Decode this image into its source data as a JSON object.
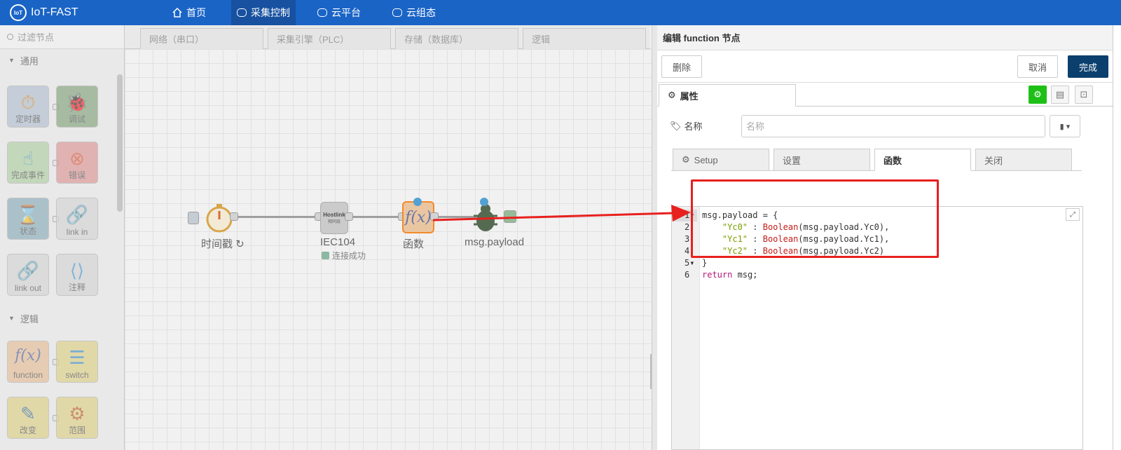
{
  "app": {
    "name": "IoT-FAST",
    "logo_text": "IoT"
  },
  "nav": [
    {
      "label": "首页",
      "icon": "home-icon"
    },
    {
      "label": "采集控制",
      "icon": "cloud-gear-icon",
      "active": true
    },
    {
      "label": "云平台",
      "icon": "cloud-icon"
    },
    {
      "label": "云组态",
      "icon": "cloud-config-icon"
    }
  ],
  "palette": {
    "filter_placeholder": "过滤节点",
    "categories": {
      "common": "通用",
      "logic": "逻辑"
    },
    "nodes": {
      "timer": "定时器",
      "debug": "调试",
      "complete": "完成事件",
      "error": "错误",
      "status": "状态",
      "link_in": "link in",
      "link_out": "link out",
      "comment": "注释",
      "function": "function",
      "switch": "switch",
      "change": "改变",
      "range": "范围"
    }
  },
  "workspace_tabs": [
    "网络（串口）",
    "采集引擎（PLC）",
    "存储（数据库）",
    "逻辑"
  ],
  "flow": {
    "timestamp_label": "时间戳 ↻",
    "iec_label": "IEC104",
    "iec_badge": "Hostlink",
    "iec_badge_sub": "相同层",
    "iec_status": "连接成功",
    "func_label": "函数",
    "debug_label": "msg.payload"
  },
  "editor": {
    "title": "编辑 function 节点",
    "delete_label": "删除",
    "cancel_label": "取消",
    "done_label": "完成",
    "props_tab": "属性",
    "name_label": "名称",
    "name_placeholder": "名称",
    "sub_tabs": [
      "Setup",
      "设置",
      "函数",
      "关闭"
    ],
    "active_sub_tab": 2,
    "code": [
      {
        "n": "1",
        "fold": true,
        "text": "msg.payload = {"
      },
      {
        "n": "2",
        "text": "    \"Yc0\" : Boolean(msg.payload.Yc0),"
      },
      {
        "n": "3",
        "text": "    \"Yc1\" : Boolean(msg.payload.Yc1),"
      },
      {
        "n": "4",
        "text": "    \"Yc2\" : Boolean(msg.payload.Yc2)"
      },
      {
        "n": "5",
        "fold": true,
        "text": "}"
      },
      {
        "n": "6",
        "text": "return msg;"
      }
    ]
  },
  "colors": {
    "topbar": "#1a64c6",
    "done_button": "#0b3f6e",
    "annotation": "#e8201e",
    "green_button": "#1ec017"
  }
}
